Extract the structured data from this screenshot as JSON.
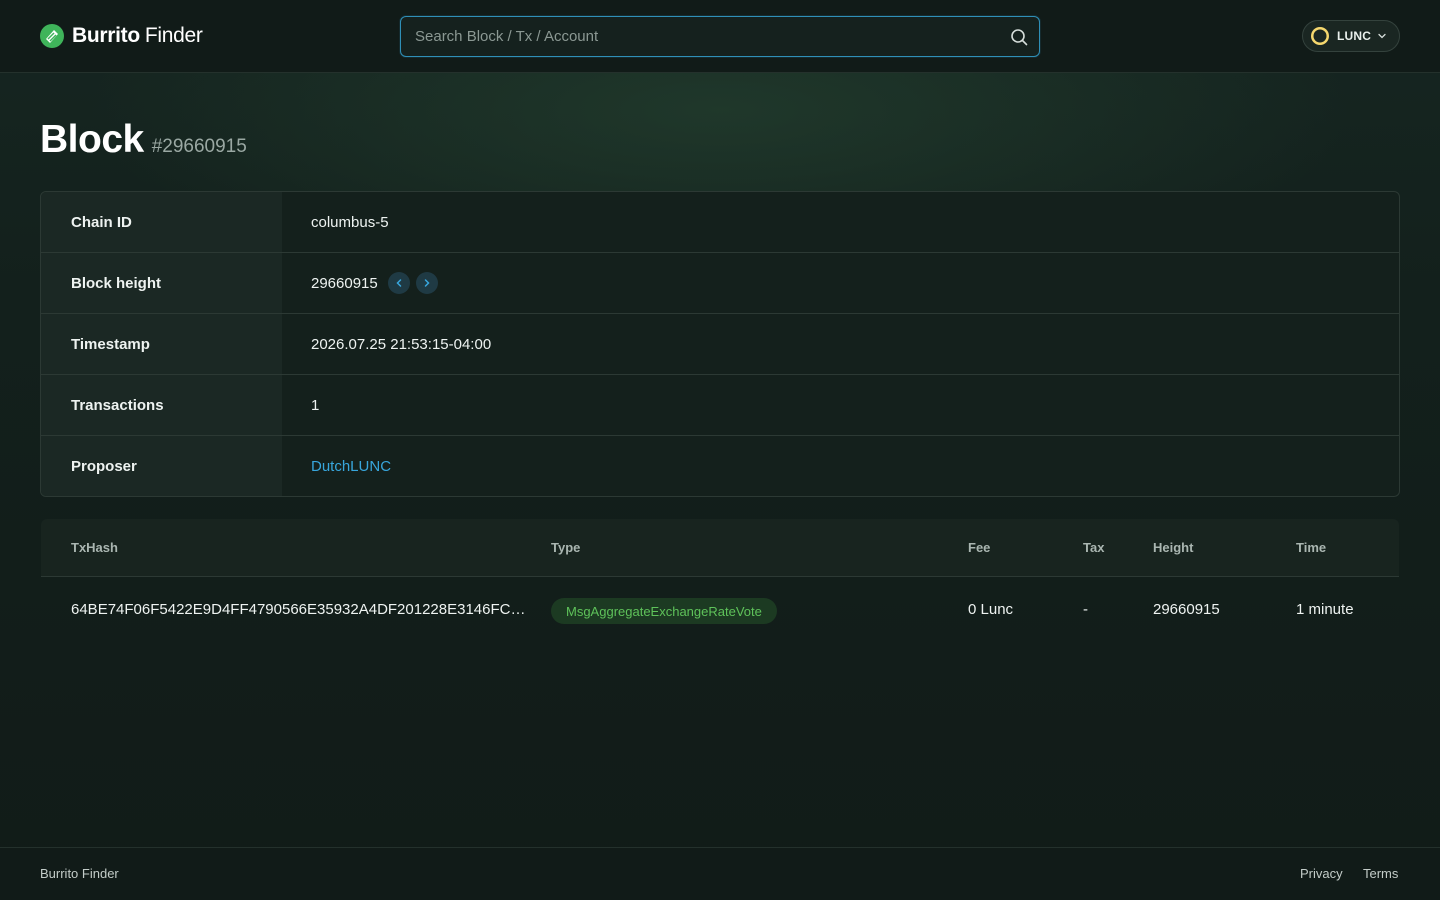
{
  "header": {
    "brand_bold": "Burrito",
    "brand_light": "Finder",
    "search_placeholder": "Search Block / Tx / Account",
    "network": "LUNC"
  },
  "page": {
    "title": "Block",
    "block_ref": "#29660915"
  },
  "block_info": {
    "rows": [
      {
        "label": "Chain ID",
        "value": "columbus-5"
      },
      {
        "label": "Block height",
        "value": "29660915"
      },
      {
        "label": "Timestamp",
        "value": "2026.07.25 21:53:15-04:00"
      },
      {
        "label": "Transactions",
        "value": "1"
      },
      {
        "label": "Proposer",
        "value": "DutchLUNC"
      }
    ]
  },
  "transactions": {
    "columns": [
      "TxHash",
      "Type",
      "Fee",
      "Tax",
      "Height",
      "Time"
    ],
    "rows": [
      {
        "hash": "64BE74F06F5422E9D4FF4790566E35932A4DF201228E3146FCD...",
        "type": "MsgAggregateExchangeRateVote",
        "fee": "0 Lunc",
        "tax": "-",
        "height": "29660915",
        "time": "1 minute"
      }
    ]
  },
  "footer": {
    "brand": "Burrito Finder",
    "links": [
      "Privacy",
      "Terms"
    ]
  },
  "colors": {
    "accent_link": "#38a6dc",
    "badge_text": "#5ec25a",
    "badge_bg": "#1c3a22",
    "background": "#111b18"
  },
  "icons": [
    "burrito-logo-icon",
    "search-icon",
    "lunc-coin-icon",
    "chevron-down-icon",
    "chevron-left-icon",
    "chevron-right-icon"
  ]
}
